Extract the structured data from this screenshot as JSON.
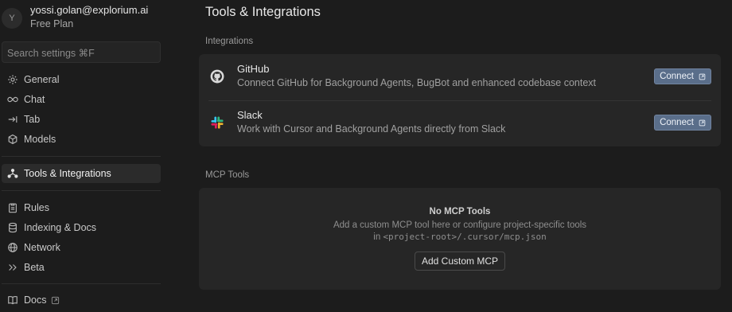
{
  "user": {
    "avatar_initial": "Y",
    "email": "yossi.golan@explorium.ai",
    "plan": "Free Plan"
  },
  "search": {
    "placeholder": "Search settings ⌘F"
  },
  "sidebar": {
    "items": [
      {
        "label": "General",
        "icon": "gear-icon"
      },
      {
        "label": "Chat",
        "icon": "infinity-icon"
      },
      {
        "label": "Tab",
        "icon": "tab-arrow-icon"
      },
      {
        "label": "Models",
        "icon": "cube-icon"
      },
      {
        "label": "Tools & Integrations",
        "icon": "network-icon",
        "active": true
      },
      {
        "label": "Rules",
        "icon": "clipboard-icon"
      },
      {
        "label": "Indexing & Docs",
        "icon": "database-icon"
      },
      {
        "label": "Network",
        "icon": "globe-icon"
      },
      {
        "label": "Beta",
        "icon": "double-chevron-icon"
      },
      {
        "label": "Docs",
        "icon": "book-icon"
      }
    ]
  },
  "main": {
    "title": "Tools & Integrations",
    "integrations": {
      "label": "Integrations",
      "items": [
        {
          "name": "GitHub",
          "description": "Connect GitHub for Background Agents, BugBot and enhanced codebase context",
          "button": "Connect",
          "icon": "github-icon"
        },
        {
          "name": "Slack",
          "description": "Work with Cursor and Background Agents directly from Slack",
          "button": "Connect",
          "icon": "slack-icon"
        }
      ]
    },
    "mcp": {
      "label": "MCP Tools",
      "empty_title": "No MCP Tools",
      "empty_line1": "Add a custom MCP tool here or configure project-specific tools",
      "empty_line2_prefix": "in",
      "empty_line2_path": "<project-root>/.cursor/mcp.json",
      "add_button": "Add Custom MCP"
    }
  },
  "colors": {
    "background": "#1c1c1c",
    "card": "#262626",
    "connect_button": "#5a6e8a",
    "active_nav": "#2b2b2b"
  }
}
